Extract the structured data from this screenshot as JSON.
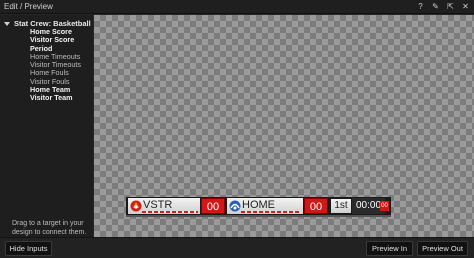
{
  "window": {
    "title": "Edit / Preview"
  },
  "title_icons": [
    "help-icon",
    "settings-icon",
    "pin-icon",
    "close-icon"
  ],
  "sidebar": {
    "root_label": "Stat Crew: Basketball",
    "items": [
      {
        "label": "Home Score",
        "bold": true
      },
      {
        "label": "Visitor Score",
        "bold": true
      },
      {
        "label": "Period",
        "bold": true
      },
      {
        "label": "Home Timeouts",
        "bold": false
      },
      {
        "label": "Visitor Timeouts",
        "bold": false
      },
      {
        "label": "Home Fouls",
        "bold": false
      },
      {
        "label": "Visitor Fouls",
        "bold": false
      },
      {
        "label": "Home Team",
        "bold": true
      },
      {
        "label": "Visitor Team",
        "bold": true
      }
    ],
    "hint": "Drag to a target in your design to connect them."
  },
  "scorebug": {
    "visitor_name": "VSTR",
    "visitor_score": "00",
    "home_name": "HOME",
    "home_score": "00",
    "period": "1st",
    "clock": "00:00",
    "shot_clock": "00",
    "colors": {
      "score": "#d01818",
      "stripe": "#c22222"
    }
  },
  "buttons": {
    "hide_inputs": "Hide Inputs",
    "preview_in": "Preview In",
    "preview_out": "Preview Out"
  }
}
